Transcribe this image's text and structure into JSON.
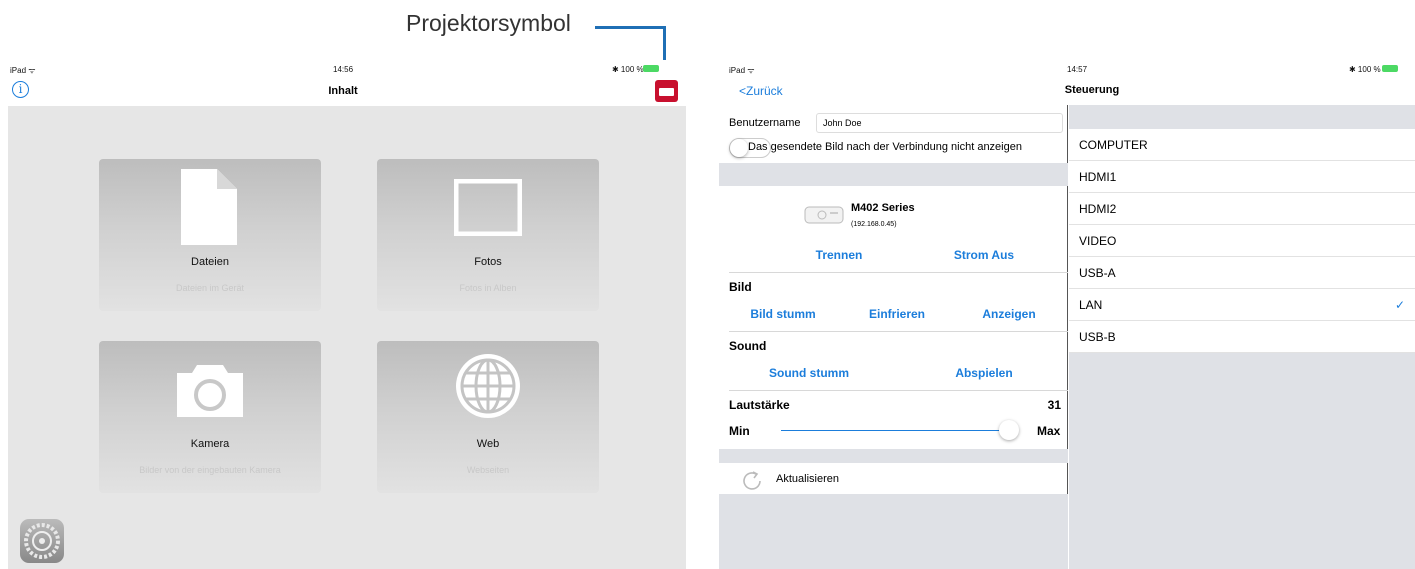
{
  "callout": {
    "label": "Projektorsymbol"
  },
  "left_screen": {
    "status": {
      "device": "iPad ᯤ",
      "time": "14:56",
      "battery": "✱ 100 %"
    },
    "nav": {
      "title": "Inhalt"
    },
    "tiles": [
      {
        "title": "Dateien",
        "subtitle": "Dateien im Gerät",
        "icon": "document-icon"
      },
      {
        "title": "Fotos",
        "subtitle": "Fotos in Alben",
        "icon": "photo-frame-icon"
      },
      {
        "title": "Kamera",
        "subtitle": "Bilder von der eingebauten Kamera",
        "icon": "camera-icon"
      },
      {
        "title": "Web",
        "subtitle": "Webseiten",
        "icon": "globe-icon"
      }
    ]
  },
  "right_screen": {
    "status": {
      "device": "iPad ᯤ",
      "time": "14:57",
      "battery": "✱ 100 %"
    },
    "nav": {
      "back": "<Zurück",
      "title": "Steuerung"
    },
    "username": {
      "label": "Benutzername",
      "value": "John Doe"
    },
    "toggle_label": "Das gesendete Bild nach der Verbindung nicht anzeigen",
    "projector": {
      "name": "M402 Series",
      "ip": "(192.168.0.45)"
    },
    "connection": {
      "disconnect": "Trennen",
      "power_off": "Strom Aus"
    },
    "image": {
      "heading": "Bild",
      "mute": "Bild stumm",
      "freeze": "Einfrieren",
      "show": "Anzeigen"
    },
    "sound": {
      "heading": "Sound",
      "mute": "Sound stumm",
      "play": "Abspielen"
    },
    "volume": {
      "heading": "Lautstärke",
      "value": "31",
      "min": "Min",
      "max": "Max",
      "level": 1.0
    },
    "refresh": "Aktualisieren",
    "sources": [
      "COMPUTER",
      "HDMI1",
      "HDMI2",
      "VIDEO",
      "USB-A",
      "LAN",
      "USB-B"
    ],
    "selected_source": "LAN",
    "check": "✓"
  },
  "colors": {
    "accent": "#1b7ddb",
    "leader": "#1f6fb5",
    "projector_icon": "#c8102e",
    "battery": "#4cd964"
  }
}
